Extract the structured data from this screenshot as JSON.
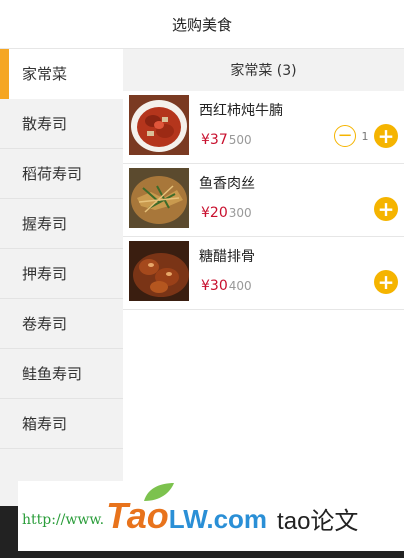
{
  "header": {
    "title": "选购美食"
  },
  "sidebar": {
    "items": [
      {
        "label": "家常菜",
        "active": true
      },
      {
        "label": "散寿司"
      },
      {
        "label": "稻荷寿司"
      },
      {
        "label": "握寿司"
      },
      {
        "label": "押寿司"
      },
      {
        "label": "卷寿司"
      },
      {
        "label": "鲑鱼寿司"
      },
      {
        "label": "箱寿司"
      }
    ]
  },
  "category": {
    "title": "家常菜 (3)"
  },
  "foods": [
    {
      "name": "西红柿炖牛腩",
      "price": "¥37",
      "old_price": "500",
      "qty": "1",
      "show_minus": true
    },
    {
      "name": "鱼香肉丝",
      "price": "¥20",
      "old_price": "300"
    },
    {
      "name": "糖醋排骨",
      "price": "¥30",
      "old_price": "400"
    }
  ],
  "buttons": {
    "plus": "+",
    "minus": "−"
  },
  "watermark": {
    "url": "http://www.",
    "logo": "Tao",
    "lw": "LW.com",
    "tail": "tao论文"
  },
  "colors": {
    "accent": "#f5b400",
    "price": "#c8102e",
    "active_bar": "#f5a623"
  }
}
